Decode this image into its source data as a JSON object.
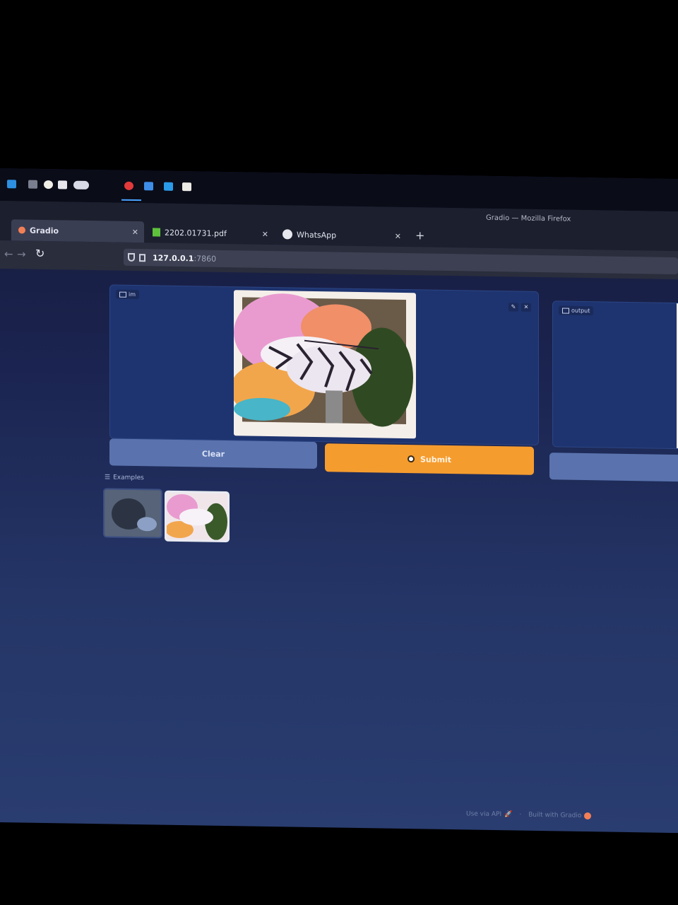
{
  "window_title": "Gradio — Mozilla Firefox",
  "tabs": [
    {
      "label": "Gradio",
      "active": true
    },
    {
      "label": "2202.01731.pdf",
      "active": false
    },
    {
      "label": "WhatsApp",
      "active": false
    }
  ],
  "address_bar": {
    "host": "127.0.0.1",
    "port": ":7860"
  },
  "input_block": {
    "label": "im"
  },
  "output_block": {
    "label": "output"
  },
  "buttons": {
    "clear": "Clear",
    "submit": "Submit"
  },
  "examples": {
    "label": "Examples"
  },
  "footer": {
    "api": "Use via API",
    "separator": "·",
    "built_with": "Built with Gradio"
  },
  "colors": {
    "accent": "#f59c2e",
    "panel": "#1e3470",
    "secondary_button": "#5a73ae"
  },
  "icons": [
    "image-icon",
    "edit-icon",
    "close-icon",
    "rocket-icon",
    "gradio-logo-icon",
    "reload-icon",
    "shield-icon",
    "page-icon"
  ]
}
